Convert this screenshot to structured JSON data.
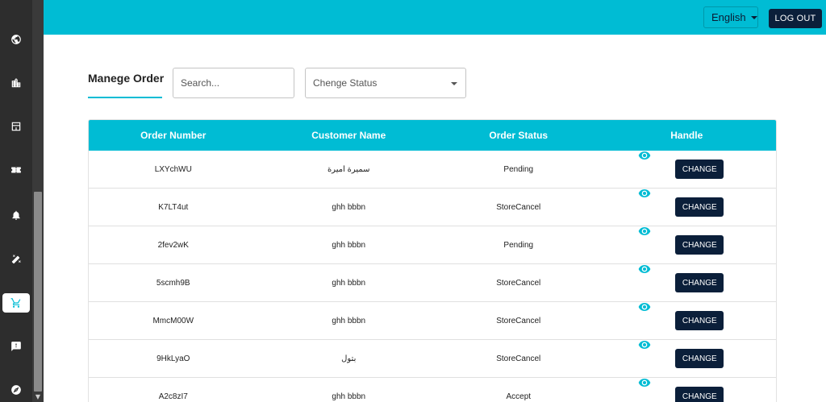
{
  "sidebar": {
    "icons": [
      "globe-icon",
      "building-icon",
      "store-icon",
      "ticket-icon",
      "bell-icon",
      "tools-icon",
      "cart-icon",
      "feedback-icon",
      "explore-icon"
    ],
    "active": "cart-icon"
  },
  "header": {
    "language": "English",
    "logout_label": "LOG OUT"
  },
  "filters": {
    "title": "Manege Order",
    "search_placeholder": "Search...",
    "status_placeholder": "Chenge Status"
  },
  "table": {
    "headers": [
      "Order Number",
      "Customer Name",
      "Order Status",
      "Handle"
    ],
    "change_label": "CHANGE",
    "rows": [
      {
        "order": "LXYchWU",
        "customer": "سميرة اميرة",
        "status": "Pending"
      },
      {
        "order": "K7LT4ut",
        "customer": "ghh bbbn",
        "status": "StoreCancel"
      },
      {
        "order": "2fev2wK",
        "customer": "ghh bbbn",
        "status": "Pending"
      },
      {
        "order": "5scmh9B",
        "customer": "ghh bbbn",
        "status": "StoreCancel"
      },
      {
        "order": "MmcM00W",
        "customer": "ghh bbbn",
        "status": "StoreCancel"
      },
      {
        "order": "9HkLyaO",
        "customer": "بتول",
        "status": "StoreCancel"
      },
      {
        "order": "A2c8zI7",
        "customer": "ghh bbbn",
        "status": "Accept"
      }
    ]
  },
  "colors": {
    "accent": "#00bcd4",
    "dark_button": "#0b1f3a",
    "sidebar": "#2d2d2d"
  }
}
